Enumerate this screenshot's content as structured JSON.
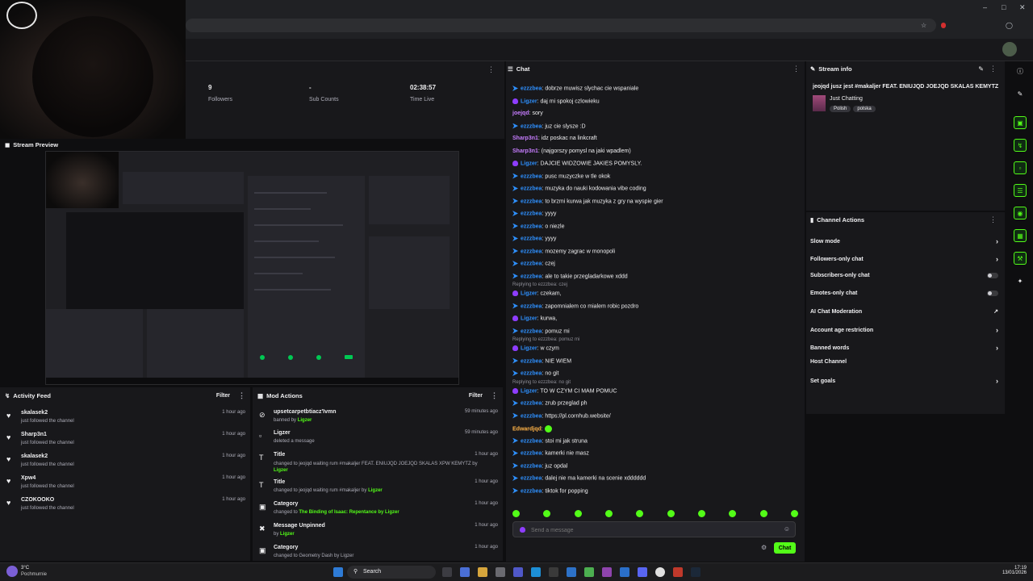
{
  "stats": [
    {
      "value": "9",
      "label": "Followers"
    },
    {
      "value": "-",
      "label": "Sub Counts"
    },
    {
      "value": "02:38:57",
      "label": "Time Live"
    }
  ],
  "preview": {
    "title": "Stream Preview"
  },
  "activity": {
    "title": "Activity Feed",
    "filter": "Filter",
    "items": [
      {
        "user": "skalasek2",
        "text": "just followed the channel",
        "time": "1 hour ago"
      },
      {
        "user": "Sharp3n1",
        "text": "just followed the channel",
        "time": "1 hour ago"
      },
      {
        "user": "skalasek2",
        "text": "just followed the channel",
        "time": "1 hour ago"
      },
      {
        "user": "Xpw4",
        "text": "just followed the channel",
        "time": "1 hour ago"
      },
      {
        "user": "CZOKOOKO",
        "text": "just followed the channel",
        "time": "1 hour ago"
      }
    ]
  },
  "mod": {
    "title": "Mod Actions",
    "filter": "Filter",
    "items": [
      {
        "title": "upsetcarpetbtiacz'Ivmn",
        "pre": "banned by ",
        "hl": "Ligzer",
        "post": "",
        "time": "59 minutes ago"
      },
      {
        "title": "Ligzer",
        "pre": "deleted a message",
        "hl": "",
        "post": "",
        "time": "59 minutes ago"
      },
      {
        "title": "Title",
        "pre": "changed to jeojqd waiting rum #makaljer FEAT. ENIUJQD JOEJQD SKALAS XPW KEMYTZ by ",
        "hl": "Ligzer",
        "post": "",
        "time": "1 hour ago"
      },
      {
        "title": "Title",
        "pre": "changed to jeojqd waiting rum #makaljer by ",
        "hl": "Ligzer",
        "post": "",
        "time": "1 hour ago"
      },
      {
        "title": "Category",
        "pre": "changed to ",
        "hl": "The Binding of Isaac: Repentance",
        "post": " by Ligzer",
        "time": "1 hour ago"
      },
      {
        "title": "Message Unpinned",
        "pre": "by ",
        "hl": "Ligzer",
        "post": "",
        "time": "1 hour ago"
      },
      {
        "title": "Category",
        "pre": "changed to Geometry Dash by Ligzer",
        "hl": "",
        "post": "",
        "time": "1 hour ago"
      }
    ]
  },
  "chat": {
    "title": "Chat",
    "placeholder": "Send a message",
    "send": "Chat",
    "messages": [
      {
        "badge": "k",
        "user": "ezzzbea",
        "color": "blue",
        "text": "dobrze muwisz slychac cie wspaniale"
      },
      {
        "badge": "p",
        "user": "Ligzer",
        "color": "blue",
        "text": "daj mi spokoj czlowieku"
      },
      {
        "badge": "",
        "user": "joejqd",
        "color": "purple",
        "text": "sory"
      },
      {
        "badge": "k",
        "user": "ezzzbea",
        "color": "blue",
        "text": "juz cie slysze :D"
      },
      {
        "badge": "",
        "user": "Sharp3n1",
        "color": "purple",
        "text": "idz poskac na linkcraft"
      },
      {
        "badge": "",
        "user": "Sharp3n1",
        "color": "purple",
        "text": "(najgorszy pomysl na jaki wpadlem)"
      },
      {
        "badge": "p",
        "user": "Ligzer",
        "color": "blue",
        "text": "DAJCIE WIDZOWIE JAKIES POMYSLY."
      },
      {
        "badge": "k",
        "user": "ezzzbea",
        "color": "blue",
        "text": "pusc muzyczke w tle okok"
      },
      {
        "badge": "k",
        "user": "ezzzbea",
        "color": "blue",
        "text": "muzyka do nauki kodowania vibe coding"
      },
      {
        "badge": "k",
        "user": "ezzzbea",
        "color": "blue",
        "text": "to brzmi kurwa jak muzyka z gry na wyspie gier"
      },
      {
        "badge": "k",
        "user": "ezzzbea",
        "color": "blue",
        "text": "yyyy"
      },
      {
        "badge": "k",
        "user": "ezzzbea",
        "color": "blue",
        "text": "o niezle"
      },
      {
        "badge": "k",
        "user": "ezzzbea",
        "color": "blue",
        "text": "yyyy"
      },
      {
        "badge": "k",
        "user": "ezzzbea",
        "color": "blue",
        "text": "mozemy zagrac w monopoli"
      },
      {
        "badge": "k",
        "user": "ezzzbea",
        "color": "blue",
        "text": "czej"
      },
      {
        "badge": "k",
        "user": "ezzzbea",
        "color": "blue",
        "text": "ale to takie przegladarkowe xddd"
      },
      {
        "reply": "Replying to ezzzbea: czej",
        "badge": "p",
        "user": "Ligzer",
        "color": "blue",
        "text": "czekam,"
      },
      {
        "badge": "k",
        "user": "ezzzbea",
        "color": "blue",
        "text": "zapomnialem co mialem robic pozdro"
      },
      {
        "badge": "p",
        "user": "Ligzer",
        "color": "blue",
        "text": "kurwa,"
      },
      {
        "badge": "k",
        "user": "ezzzbea",
        "color": "blue",
        "text": "pomuz mi"
      },
      {
        "reply": "Replying to ezzzbea: pomuz mi",
        "badge": "p",
        "user": "Ligzer",
        "color": "blue",
        "text": "w czym"
      },
      {
        "badge": "k",
        "user": "ezzzbea",
        "color": "blue",
        "text": "NIE WIEM"
      },
      {
        "badge": "k",
        "user": "ezzzbea",
        "color": "blue",
        "text": "no git"
      },
      {
        "reply": "Replying to ezzzbea: no git",
        "badge": "p",
        "user": "Ligzer",
        "color": "blue",
        "text": "TO W CZYM CI MAM POMUC"
      },
      {
        "badge": "k",
        "user": "ezzzbea",
        "color": "blue",
        "text": "zrub przeglad ph"
      },
      {
        "badge": "k",
        "user": "ezzzbea",
        "color": "blue",
        "text": "https://pl.cornhub.website/"
      },
      {
        "badge": "",
        "user": "Edwardjqd",
        "color": "orange",
        "text": ""
      },
      {
        "badge": "k",
        "user": "ezzzbea",
        "color": "blue",
        "text": "stoi mi jak struna"
      },
      {
        "badge": "k",
        "user": "ezzzbea",
        "color": "blue",
        "text": "kamerki nie masz"
      },
      {
        "badge": "k",
        "user": "ezzzbea",
        "color": "blue",
        "text": "juz opdal"
      },
      {
        "badge": "k",
        "user": "ezzzbea",
        "color": "blue",
        "text": "dalej nie ma kamerki na scenie xdddddd"
      },
      {
        "badge": "k",
        "user": "ezzzbea",
        "color": "blue",
        "text": "tiktok for popping"
      }
    ]
  },
  "streaminfo": {
    "title": "Stream info",
    "stream_title": "jeojqd jusz jest #makaljer FEAT. ENIUJQD JOEJQD SKALAS KEMYTZ",
    "category": "Just Chatting",
    "tags": [
      "Polish",
      "polska"
    ]
  },
  "chanact": {
    "title": "Channel Actions",
    "options": [
      {
        "label": "Slow mode",
        "ctl": "chev"
      },
      {
        "label": "Followers-only chat",
        "ctl": "chev"
      },
      {
        "label": "Subscribers-only chat",
        "ctl": "toggle"
      },
      {
        "label": "Emotes-only chat",
        "ctl": "toggle"
      },
      {
        "label": "AI Chat Moderation",
        "ctl": "ext"
      },
      {
        "label": "Account age restriction",
        "ctl": "chev"
      },
      {
        "label": "Banned words",
        "ctl": "chev"
      },
      {
        "label": "Host Channel",
        "ctl": ""
      },
      {
        "label": "Set goals",
        "ctl": "chev"
      }
    ]
  },
  "taskbar": {
    "weather_temp": "3°C",
    "weather_desc": "Pochmurnie",
    "search": "Search",
    "time": "17:19",
    "date": "13/01/2026"
  },
  "colors": {
    "accent": "#53fc18",
    "bg": "#0e0e10",
    "panel": "#18181b"
  }
}
